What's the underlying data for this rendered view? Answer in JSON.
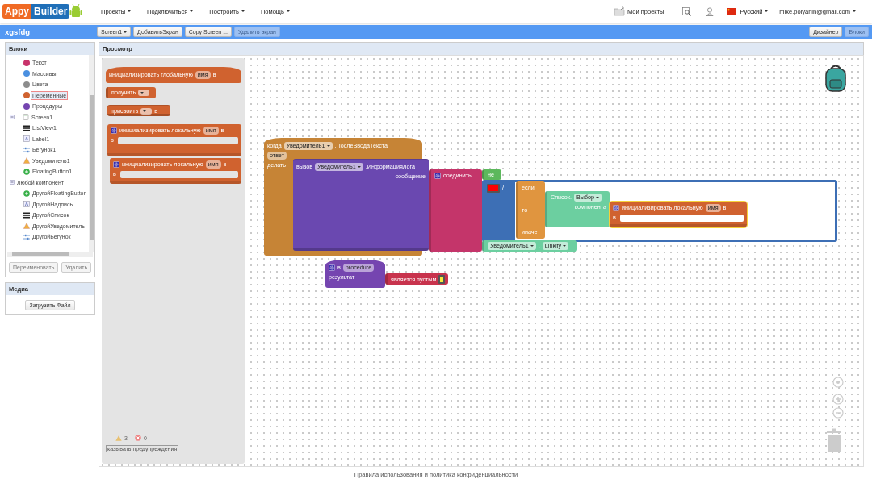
{
  "logo": {
    "left": "Appy",
    "right": "Builder"
  },
  "menu": [
    {
      "label": "Проекты"
    },
    {
      "label": "Подключиться"
    },
    {
      "label": "Построить"
    },
    {
      "label": "Помощь"
    }
  ],
  "top_right": {
    "my_projects": "Мои проекты",
    "language": "Русский",
    "account": "mike.polyanin@gmail.com"
  },
  "project": {
    "name": "xgsfdg",
    "buttons": [
      {
        "label": "Screen1",
        "kind": "dropdown",
        "disabled": false
      },
      {
        "label": "ДобавитьЭкран",
        "kind": "plain",
        "disabled": false
      },
      {
        "label": "Copy Screen ...",
        "kind": "plain",
        "disabled": false
      },
      {
        "label": "Удалить экран",
        "kind": "plain",
        "disabled": true
      }
    ]
  },
  "views": [
    {
      "label": "Дизайнер",
      "selected": false
    },
    {
      "label": "Блоки",
      "selected": true
    }
  ],
  "blocks_panel": {
    "title": "Блоки",
    "tree": [
      {
        "label": "Текст",
        "kind": "builtin",
        "color": "#c8336b",
        "selected": false
      },
      {
        "label": "Массивы",
        "kind": "builtin",
        "color": "#4a8fe0",
        "selected": false
      },
      {
        "label": "Цвета",
        "kind": "builtin",
        "color": "#8c8c8c",
        "selected": false
      },
      {
        "label": "Переменные",
        "kind": "builtin",
        "color": "#d0622f",
        "selected": true
      },
      {
        "label": "Процедуры",
        "kind": "builtin",
        "color": "#7545b0",
        "selected": false
      },
      {
        "label": "Screen1",
        "kind": "screen",
        "expanded": true,
        "selected": false,
        "children": [
          {
            "label": "ListView1",
            "kind": "list",
            "selected": false
          },
          {
            "label": "Label1",
            "kind": "label",
            "selected": false
          },
          {
            "label": "Бегунок1",
            "kind": "slider",
            "selected": false
          },
          {
            "label": "Уведомитель1",
            "kind": "notifier",
            "selected": false
          },
          {
            "label": "FloatingButton1",
            "kind": "button",
            "selected": false
          }
        ]
      },
      {
        "label": "Любой компонент",
        "kind": "group",
        "expanded": true,
        "selected": false,
        "children": [
          {
            "label": "ДругойFloatingButton",
            "kind": "button",
            "selected": false
          },
          {
            "label": "ДругойНадпись",
            "kind": "label",
            "selected": false
          },
          {
            "label": "ДругойСписок",
            "kind": "list",
            "selected": false
          },
          {
            "label": "ДругойУведомитель",
            "kind": "notifier",
            "selected": false
          },
          {
            "label": "ДругойБегунок",
            "kind": "slider",
            "selected": false
          }
        ]
      }
    ],
    "buttons": [
      {
        "label": "Переименовать"
      },
      {
        "label": "Удалить"
      }
    ]
  },
  "media": {
    "title": "Медиа",
    "button": "Загрузить Файл"
  },
  "viewer": {
    "title": "Просмотр",
    "warnings": "3",
    "errors": "0",
    "warnings_toggle": "казывать предупреждения"
  },
  "flyout_blocks": [
    {
      "kind": "hat",
      "color": "#d0622f",
      "selected": false,
      "rows": [
        {
          "tokens": [
            {
              "kind": "label",
              "text": "инициализировать глобальную"
            },
            {
              "kind": "field",
              "text": "имя"
            },
            {
              "kind": "label",
              "text": "в"
            }
          ]
        }
      ]
    },
    {
      "kind": "value",
      "color": "#d0622f",
      "selected": false,
      "rows": [
        {
          "tokens": [
            {
              "kind": "label",
              "text": "получить"
            },
            {
              "kind": "dropdown"
            }
          ]
        }
      ]
    },
    {
      "kind": "statement",
      "color": "#d0622f",
      "selected": false,
      "rows": [
        {
          "tokens": [
            {
              "kind": "label",
              "text": "присвоить"
            },
            {
              "kind": "dropdown"
            },
            {
              "kind": "label",
              "text": "в"
            }
          ]
        }
      ]
    },
    {
      "kind": "c_block",
      "color": "#d0622f",
      "selected": false,
      "rows": [
        {
          "tokens": [
            {
              "kind": "gear"
            },
            {
              "kind": "label",
              "text": "инициализировать локальную"
            },
            {
              "kind": "field",
              "text": "имя"
            },
            {
              "kind": "label",
              "text": "в"
            }
          ]
        },
        {
          "tokens": [
            {
              "kind": "label",
              "text": "в"
            }
          ]
        }
      ]
    },
    {
      "kind": "c_block",
      "color": "#d0622f",
      "selected": false,
      "rows": [
        {
          "tokens": [
            {
              "kind": "gear"
            },
            {
              "kind": "label",
              "text": "инициализировать локальную"
            },
            {
              "kind": "field",
              "text": "имя"
            },
            {
              "kind": "label",
              "text": "в"
            }
          ]
        },
        {
          "tokens": [
            {
              "kind": "label",
              "text": "в"
            }
          ]
        }
      ]
    }
  ],
  "workspace_blocks": [
    {
      "kind": "hat",
      "color": "#c68436",
      "selected": false,
      "rows": [
        {
          "tokens": [
            {
              "kind": "label",
              "text": "когда"
            },
            {
              "kind": "dropdown",
              "text": "Уведомитель1"
            },
            {
              "kind": "label",
              "text": ".ПослеВводаТекста"
            }
          ]
        },
        {
          "tokens": [
            {
              "kind": "field",
              "text": "ответ"
            }
          ]
        },
        {
          "tokens": [
            {
              "kind": "label",
              "text": "делать"
            }
          ]
        }
      ]
    },
    {
      "kind": "statement",
      "color": "#6a48b0",
      "selected": false,
      "rows": [
        {
          "tokens": [
            {
              "kind": "label",
              "text": "вызов"
            },
            {
              "kind": "dropdown",
              "text": "Уведомитель1"
            },
            {
              "kind": "label",
              "text": ".ИнформацияЛога"
            }
          ]
        },
        {
          "tokens": [
            {
              "kind": "label",
              "text": "сообщение"
            }
          ]
        }
      ]
    },
    {
      "kind": "value",
      "color": "#c4356a",
      "selected": false,
      "rows": [
        {
          "tokens": [
            {
              "kind": "gear"
            },
            {
              "kind": "label",
              "text": "соединить"
            }
          ]
        }
      ]
    },
    {
      "kind": "value",
      "color": "#5cb85c",
      "selected": false,
      "rows": [
        {
          "tokens": [
            {
              "kind": "label",
              "text": "не"
            }
          ]
        }
      ]
    },
    {
      "kind": "container",
      "color": "#3d6fb5",
      "selected": false,
      "rows": [
        {
          "tokens": [
            {
              "kind": "swatch",
              "color": "#ff0000"
            },
            {
              "kind": "label",
              "text": "/"
            }
          ]
        }
      ]
    },
    {
      "kind": "value",
      "color": "#e0953f",
      "selected": false,
      "rows": [
        {
          "tokens": [
            {
              "kind": "label",
              "text": "если"
            }
          ]
        },
        {
          "tokens": [
            {
              "kind": "label",
              "text": "то"
            }
          ]
        },
        {
          "tokens": [
            {
              "kind": "label",
              "text": "иначе"
            }
          ]
        }
      ]
    },
    {
      "kind": "value",
      "color": "#6ccfa0",
      "selected": false,
      "rows": [
        {
          "tokens": [
            {
              "kind": "label",
              "text": "Список."
            },
            {
              "kind": "dropdown",
              "text": "Выбор"
            }
          ]
        },
        {
          "tokens": [
            {
              "kind": "label",
              "text": "компонента"
            }
          ]
        }
      ]
    },
    {
      "kind": "c_block",
      "color": "#d0622f",
      "selected": true,
      "rows": [
        {
          "tokens": [
            {
              "kind": "gear"
            },
            {
              "kind": "label",
              "text": "инициализировать локальную"
            },
            {
              "kind": "field",
              "text": "имя"
            },
            {
              "kind": "label",
              "text": "в"
            }
          ]
        },
        {
          "tokens": [
            {
              "kind": "label",
              "text": "в"
            }
          ]
        }
      ]
    },
    {
      "kind": "value",
      "color": "#6ccfa0",
      "selected": false,
      "rows": [
        {
          "tokens": [
            {
              "kind": "dropdown",
              "text": "Уведомитель1"
            },
            {
              "kind": "label",
              "text": "."
            },
            {
              "kind": "dropdown",
              "text": "Linkify"
            }
          ]
        }
      ]
    },
    {
      "kind": "hat",
      "color": "#7545b0",
      "selected": false,
      "rows": [
        {
          "tokens": [
            {
              "kind": "gear"
            },
            {
              "kind": "label",
              "text": "в"
            },
            {
              "kind": "field",
              "text": "procedure"
            }
          ]
        },
        {
          "tokens": [
            {
              "kind": "label",
              "text": "результат"
            }
          ]
        }
      ]
    },
    {
      "kind": "value",
      "color": "#c8334d",
      "selected": false,
      "rows": [
        {
          "tokens": [
            {
              "kind": "label",
              "text": "является пустым"
            },
            {
              "kind": "swatch",
              "color": "#f5e93a"
            }
          ]
        }
      ]
    }
  ],
  "footer": "Правила использования и политика конфиденциальности"
}
